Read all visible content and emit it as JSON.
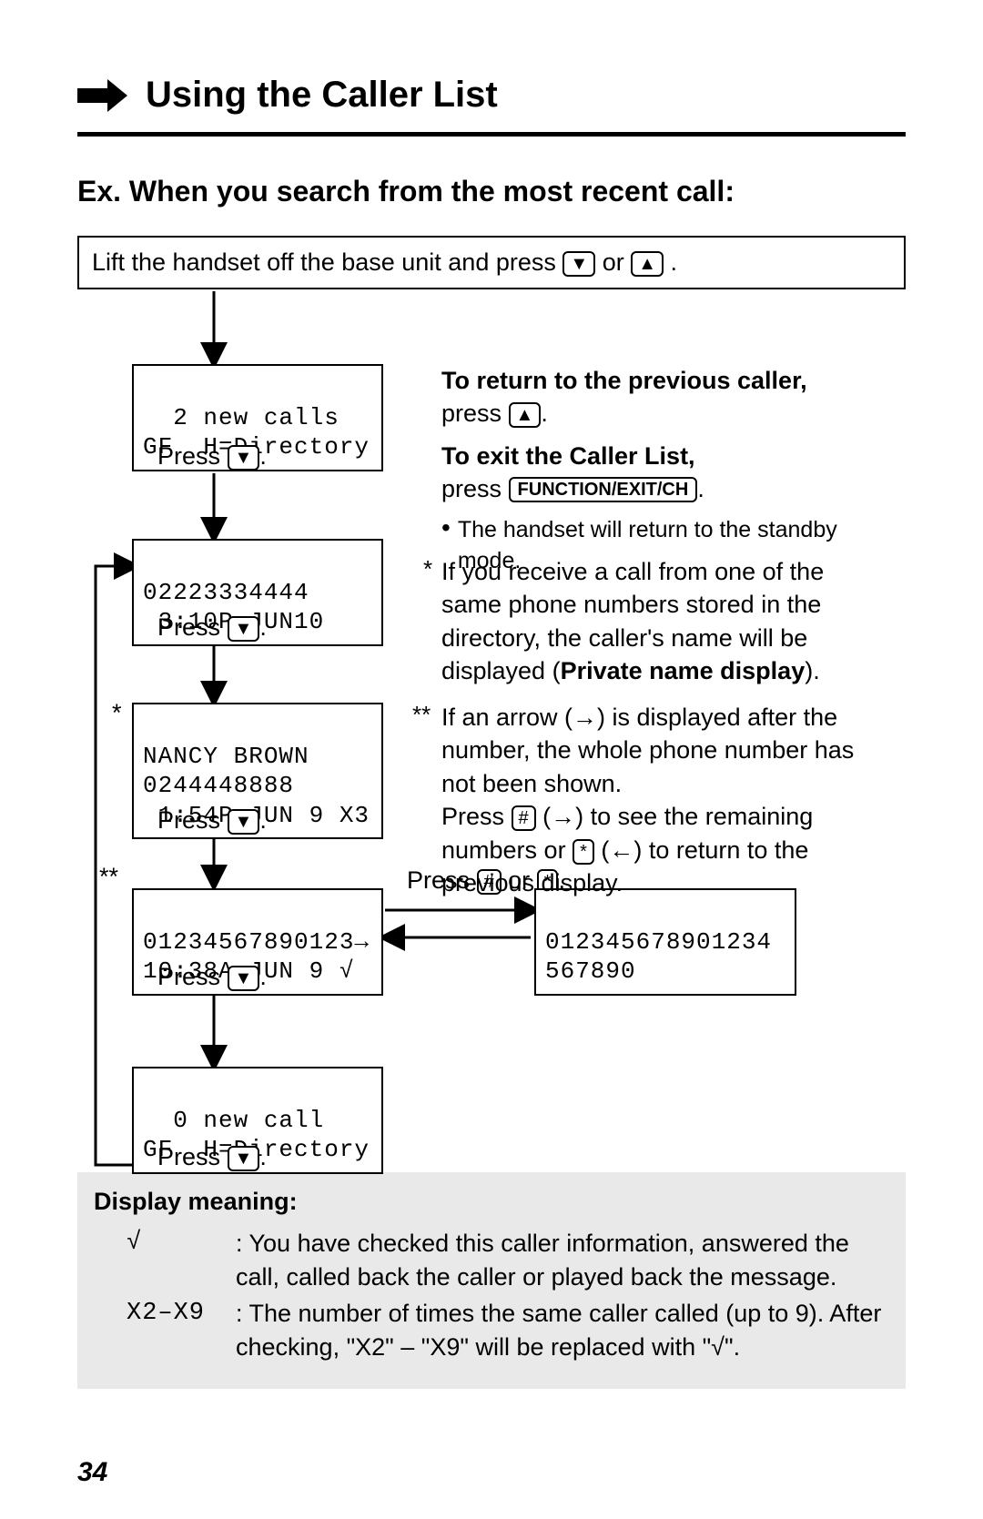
{
  "title": "Using the Caller List",
  "subtitle": "Ex. When you search from the most recent call:",
  "intro": {
    "prefix": "Lift the handset off the base unit and press ",
    "or": " or ",
    "end": "."
  },
  "screens": {
    "s1": {
      "l1": "  2 new calls",
      "l2": "GF  H=Directory"
    },
    "s2": {
      "l1": "02223334444",
      "l2": " 3:10P JUN10"
    },
    "s3": {
      "l1": "NANCY BROWN",
      "l2": "0244448888",
      "l3": " 1:54P JUN 9 X3"
    },
    "s4": {
      "l1": "01234567890123→",
      "l2": "10:38A JUN 9 √"
    },
    "s4b": {
      "l1": "012345678901234",
      "l2": "567890"
    },
    "s5": {
      "l1": "  0 new call",
      "l2": "GF  H=Directory"
    }
  },
  "captions": {
    "pressDown": "Press ",
    "dot": ".",
    "pressHashStar_pre": "Press ",
    "pressHashStar_or": " or ",
    "hash": "#",
    "star": "*"
  },
  "right": {
    "r1_bold": "To return to the previous caller,",
    "r1_rest_pre": "press ",
    "r1_rest_post": ".",
    "r2_bold": "To exit the Caller List,",
    "r2_rest_pre": "press ",
    "r2_btn": "FUNCTION/EXIT/CH",
    "r2_rest_post": ".",
    "bullet": "The handset will return to the standby mode.",
    "note1_a": "If you receive a call from one of the same phone numbers stored in the directory, the caller's name will be displayed (",
    "note1_bold": "Private name display",
    "note1_b": ").",
    "note2_a": "If an arrow (→) is displayed after the number, the whole phone number has not been shown.",
    "note2_b_pre": "Press ",
    "note2_b_mid": " (→) to see the remaining numbers or ",
    "note2_b_post": " (←) to return to the previous display."
  },
  "asterisks": {
    "one": "*",
    "two": "**"
  },
  "meaning": {
    "header": "Display meaning:",
    "rows": [
      {
        "sym": "√",
        "text": "You have checked this caller information, answered the call, called back the caller or played back the message."
      },
      {
        "sym": "X2–X9",
        "text": "The number of times the same caller called (up to 9). After checking, \"X2\" – \"X9\" will be replaced with \"√\"."
      }
    ]
  },
  "pageNumber": "34",
  "glyphs": {
    "down": "▼",
    "up": "▲"
  }
}
